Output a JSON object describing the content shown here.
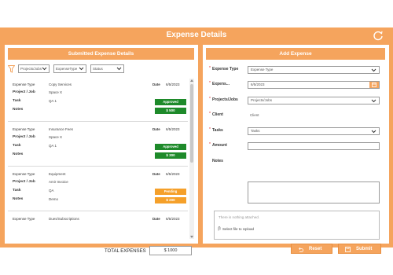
{
  "app": {
    "title": "Expense Details"
  },
  "left": {
    "title": "Submitted Expense Details",
    "filters": [
      {
        "label": "Projects/Jobs"
      },
      {
        "label": "ExpenseType"
      },
      {
        "label": "Status"
      }
    ],
    "labels": {
      "expense_type": "Expense Type",
      "project": "Project / Job",
      "task": "Task",
      "notes": "Notes",
      "date": "Date"
    },
    "items": [
      {
        "expense_type": "Copy Services",
        "project": "Space X",
        "task": "QA 1",
        "notes": "",
        "date": "6/5/2023",
        "status": "Approved",
        "status_color": "#1e8a2a",
        "amount": "$ 500",
        "amount_color": "#1e8a2a"
      },
      {
        "expense_type": "Insurance Fees",
        "project": "Space X",
        "task": "QA 1",
        "notes": "",
        "date": "6/5/2023",
        "status": "Approved",
        "status_color": "#1e8a2a",
        "amount": "$ 300",
        "amount_color": "#1e8a2a"
      },
      {
        "expense_type": "Equipment",
        "project": "Amir Invoice",
        "task": "QA",
        "notes": "Demo",
        "date": "6/5/2023",
        "status": "Pending",
        "status_color": "#f5a02a",
        "amount": "$ 200",
        "amount_color": "#f5a02a"
      },
      {
        "expense_type": "Dues/Subscriptions",
        "project": "",
        "task": "",
        "notes": "",
        "date": "6/5/2023",
        "status": "",
        "status_color": "",
        "amount": "",
        "amount_color": ""
      }
    ],
    "total_label": "TOTAL EXPENSES",
    "total_value": "$ 1000"
  },
  "right": {
    "title": "Add Expense",
    "fields": {
      "expense_type": {
        "label": "Expense Type",
        "value": "Expense Type"
      },
      "expense_date": {
        "label": "Expens...",
        "value": "6/5/2023"
      },
      "projects": {
        "label": "Projects/Jobs",
        "value": "Projects/Jobs"
      },
      "client": {
        "label": "Client",
        "value": "Client"
      },
      "tasks": {
        "label": "Tasks",
        "value": "Tasks"
      },
      "amount": {
        "label": "Amount",
        "value": ""
      },
      "notes": {
        "label": "Notes",
        "value": ""
      }
    },
    "attachments": {
      "empty_text": "There is nothing attached.",
      "upload_label": "Select file to Upload"
    },
    "reset_label": "Reset",
    "submit_label": "Submit"
  },
  "colors": {
    "accent": "#f5a45d",
    "approved": "#1e8a2a",
    "pending": "#f5a02a",
    "required": "#e02020"
  }
}
